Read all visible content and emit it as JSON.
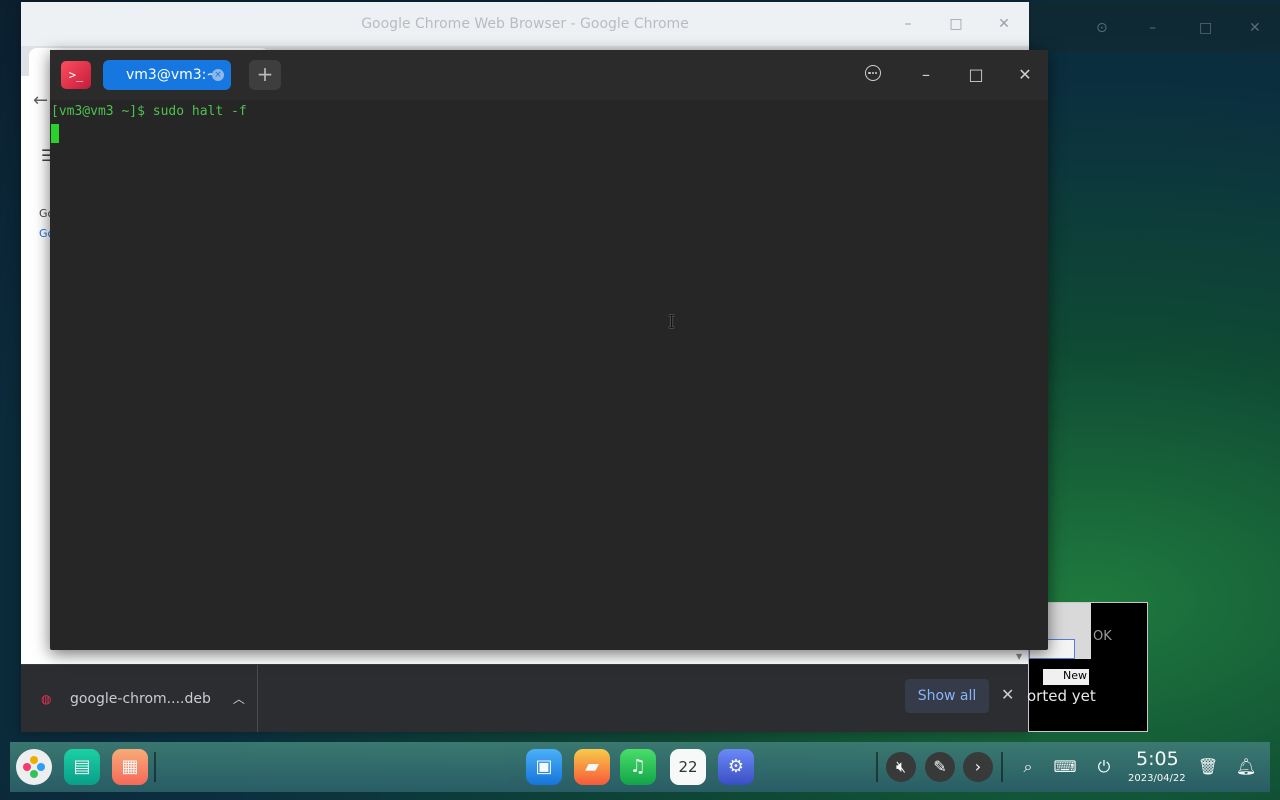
{
  "chrome_window": {
    "title": "Google Chrome Web Browser - Google Chrome",
    "page_text_1": "Go",
    "page_text_2": "Go"
  },
  "downloads": {
    "file_name": "google-chrom....deb",
    "show_all_label": "Show all"
  },
  "dialog": {
    "ok_fragment": "OK",
    "new_button_fragment": "New",
    "message_fragment": "orted yet"
  },
  "terminal": {
    "tab_label": "vm3@vm3:~",
    "prompt_line": "[vm3@vm3 ~]$ sudo halt -f"
  },
  "dock": {
    "apps": [
      "launcher-icon",
      "terminal-icon",
      "app-store-icon",
      "file-manager-icon",
      "image-viewer-icon",
      "music-icon",
      "calendar-icon",
      "settings-icon"
    ],
    "calendar_day": "22",
    "clock_time": "5:05",
    "clock_date": "2023/04/22"
  },
  "colors": {
    "terminal_accent": "#1677e0",
    "prompt_green": "#4ec04e",
    "dock_bg": "#2f6a6c"
  }
}
